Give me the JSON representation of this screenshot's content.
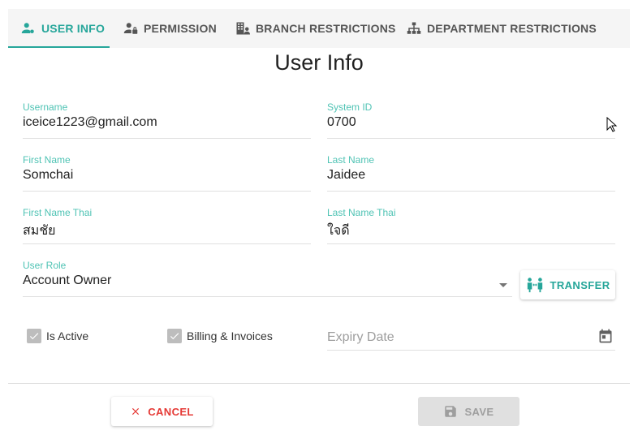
{
  "tabs": [
    {
      "label": "USER INFO",
      "icon": "user-gear-icon",
      "active": true
    },
    {
      "label": "PERMISSION",
      "icon": "user-lock-icon",
      "active": false
    },
    {
      "label": "BRANCH RESTRICTIONS",
      "icon": "building-user-icon",
      "active": false
    },
    {
      "label": "DEPARTMENT RESTRICTIONS",
      "icon": "sitemap-icon",
      "active": false
    }
  ],
  "title": "User Info",
  "fields": {
    "username": {
      "label": "Username",
      "value": "iceice1223@gmail.com"
    },
    "system_id": {
      "label": "System ID",
      "value": "0700"
    },
    "first_name": {
      "label": "First Name",
      "value": "Somchai"
    },
    "last_name": {
      "label": "Last Name",
      "value": "Jaidee"
    },
    "first_name_thai": {
      "label": "First Name Thai",
      "value": "สมชัย"
    },
    "last_name_thai": {
      "label": "Last Name Thai",
      "value": "ใจดี"
    },
    "user_role": {
      "label": "User Role",
      "value": "Account Owner"
    },
    "expiry_date": {
      "placeholder": "Expiry Date"
    }
  },
  "checkboxes": {
    "is_active": {
      "label": "Is Active",
      "checked": true
    },
    "billing": {
      "label": "Billing & Invoices",
      "checked": true
    }
  },
  "buttons": {
    "transfer": "TRANSFER",
    "cancel": "CANCEL",
    "save": "SAVE"
  },
  "colors": {
    "accent": "#26a69a",
    "label": "#4fc3b4",
    "cancel": "#e53935",
    "disabled": "#e0e0e0"
  }
}
